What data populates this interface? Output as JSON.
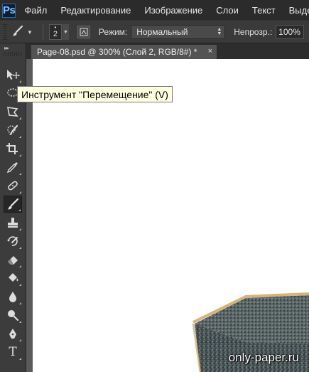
{
  "app": {
    "logo": "Ps",
    "logo_color": "#7ec3ff"
  },
  "menu": [
    "Файл",
    "Редактирование",
    "Изображение",
    "Слои",
    "Текст",
    "Выделение"
  ],
  "options": {
    "tool_icon": "brush-icon",
    "brush_size": "2",
    "mode_label": "Режим:",
    "mode_value": "Нормальный",
    "opacity_label": "Непрозр.:",
    "opacity_value": "100%"
  },
  "document": {
    "tab_title": "Page-08.psd @ 300% (Слой 2, RGB/8#) *",
    "close_glyph": "×"
  },
  "tooltip": {
    "text": "Инструмент \"Перемещение\" (V)"
  },
  "toolbar": {
    "tools": [
      {
        "name": "move-tool",
        "icon": "move-icon",
        "active": false
      },
      {
        "name": "marquee-tool",
        "icon": "lasso-icon",
        "active": false
      },
      {
        "name": "polygonal-lasso-tool",
        "icon": "polygonal-lasso-icon",
        "active": false
      },
      {
        "name": "quick-selection-tool",
        "icon": "quick-selection-icon",
        "active": false
      },
      {
        "name": "crop-tool",
        "icon": "crop-icon",
        "active": false
      },
      {
        "name": "eyedropper-tool",
        "icon": "eyedropper-icon",
        "active": false
      },
      {
        "name": "healing-brush-tool",
        "icon": "bandage-icon",
        "active": false
      },
      {
        "name": "brush-tool",
        "icon": "brush-icon",
        "active": true
      },
      {
        "name": "clone-stamp-tool",
        "icon": "stamp-icon",
        "active": false
      },
      {
        "name": "history-brush-tool",
        "icon": "history-brush-icon",
        "active": false
      },
      {
        "name": "eraser-tool",
        "icon": "eraser-icon",
        "active": false
      },
      {
        "name": "paint-bucket-tool",
        "icon": "bucket-icon",
        "active": false
      },
      {
        "name": "blur-tool",
        "icon": "drop-icon",
        "active": false
      },
      {
        "name": "dodge-tool",
        "icon": "dodge-icon",
        "active": false
      },
      {
        "name": "pen-tool",
        "icon": "pen-icon",
        "active": false
      },
      {
        "name": "type-tool",
        "icon": "type-icon",
        "active": false
      }
    ],
    "type_glyph": "T"
  },
  "watermark": "only-paper.ru",
  "colors": {
    "canvas": "#ffffff",
    "tooltip_bg": "#ffffe1",
    "ui_dark": "#2b2b2b"
  }
}
